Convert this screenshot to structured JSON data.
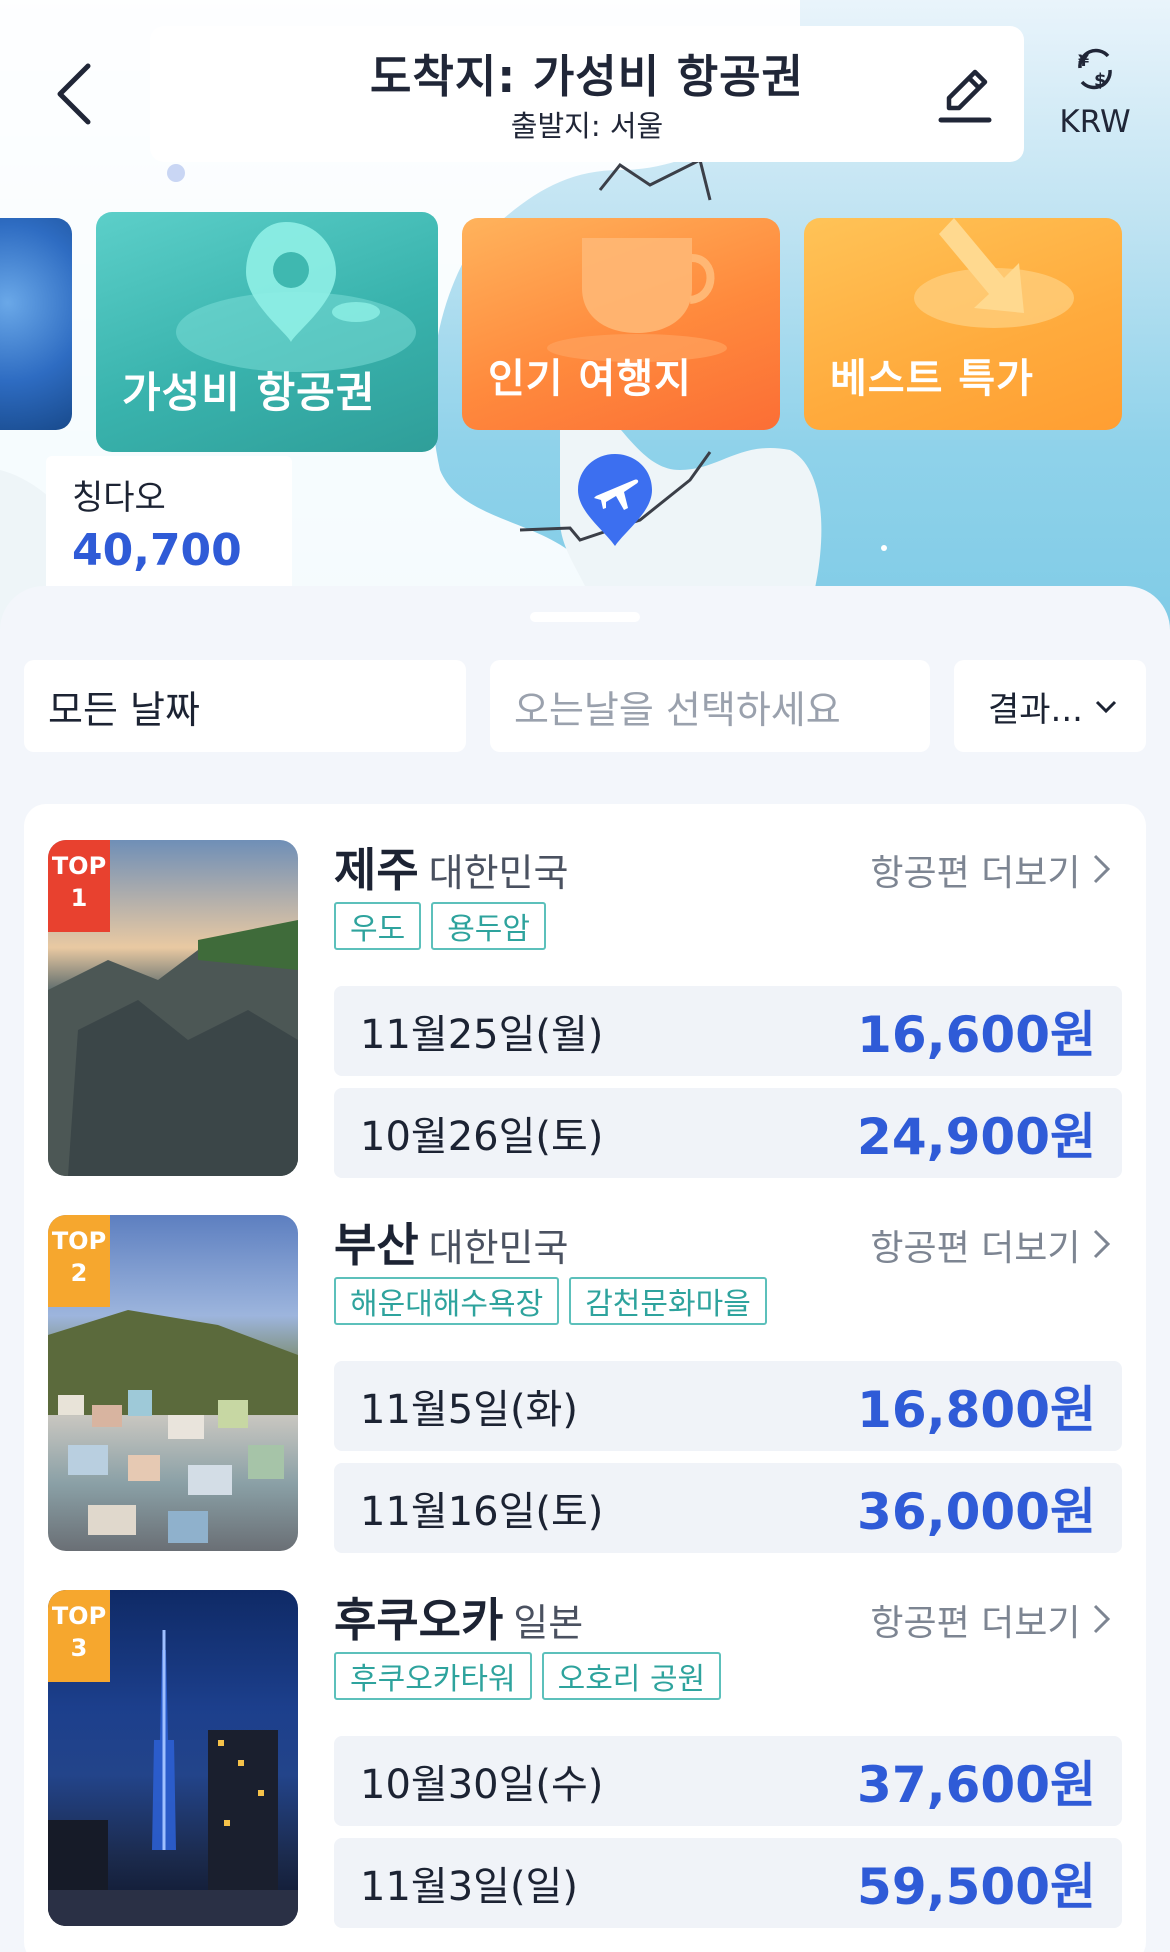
{
  "header": {
    "title": "도착지: 가성비 항공권",
    "subtitle": "출발지: 서울",
    "currency": "KRW"
  },
  "categories": [
    {
      "label": "가성비 항공권"
    },
    {
      "label": "인기 여행지"
    },
    {
      "label": "베스트 특가"
    }
  ],
  "map_bubble": {
    "city": "칭다오",
    "price": "40,700원"
  },
  "filters": {
    "depart": "모든 날짜",
    "return_placeholder": "오는날을 선택하세요",
    "sort": "결과..."
  },
  "more_label": "항공편 더보기",
  "destinations": [
    {
      "rank_top": "TOP",
      "rank_num": "1",
      "city": "제주",
      "country": "대한민국",
      "tags": [
        "우도",
        "용두암"
      ],
      "fares": [
        {
          "date": "11월25일(월)",
          "price": "16,600원"
        },
        {
          "date": "10월26일(토)",
          "price": "24,900원"
        }
      ]
    },
    {
      "rank_top": "TOP",
      "rank_num": "2",
      "city": "부산",
      "country": "대한민국",
      "tags": [
        "해운대해수욕장",
        "감천문화마을"
      ],
      "fares": [
        {
          "date": "11월5일(화)",
          "price": "16,800원"
        },
        {
          "date": "11월16일(토)",
          "price": "36,000원"
        }
      ]
    },
    {
      "rank_top": "TOP",
      "rank_num": "3",
      "city": "후쿠오카",
      "country": "일본",
      "tags": [
        "후쿠오카타워",
        "오호리 공원"
      ],
      "fares": [
        {
          "date": "10월30일(수)",
          "price": "37,600원"
        },
        {
          "date": "11월3일(일)",
          "price": "59,500원"
        }
      ]
    }
  ],
  "colors": {
    "accent_blue": "#2f5bd7",
    "tag_teal": "#2ea39d",
    "rank_red": "#e8412f",
    "rank_orange": "#f6a72e"
  }
}
